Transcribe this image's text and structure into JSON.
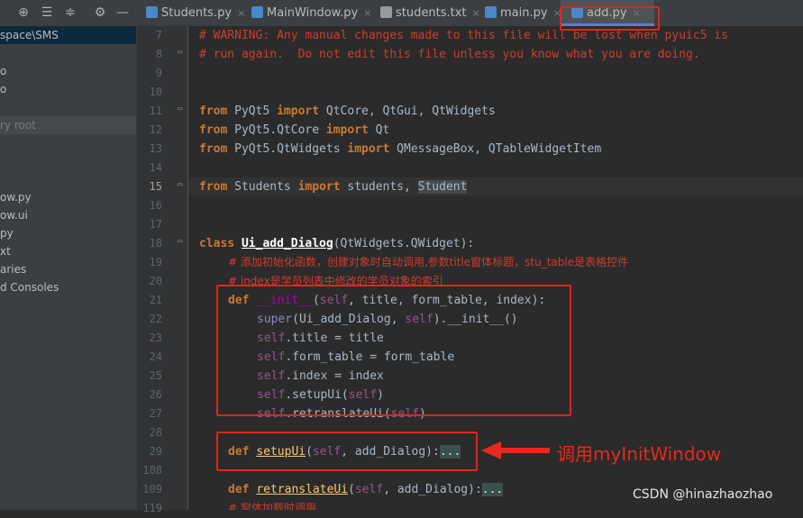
{
  "toolbar": {
    "icons": [
      "target-icon",
      "collapse-all-icon",
      "expand-all-icon",
      "gear-icon",
      "minimize-icon"
    ]
  },
  "project_tree": {
    "items": [
      {
        "label": "space\\SMS"
      },
      {
        "label": "o"
      },
      {
        "label": "o"
      },
      {
        "label": "ry root"
      },
      {
        "label": "ow.py"
      },
      {
        "label": "ow.ui"
      },
      {
        "label": "py"
      },
      {
        "label": "xt"
      },
      {
        "label": "aries"
      },
      {
        "label": "d Consoles"
      }
    ]
  },
  "tabs": [
    {
      "label": "Students.py",
      "close": "×",
      "color": "#4a88c7"
    },
    {
      "label": "MainWindow.py",
      "close": "×",
      "color": "#4a88c7"
    },
    {
      "label": "students.txt",
      "close": "×",
      "color": "#9a9a9a"
    },
    {
      "label": "main.py",
      "close": "×",
      "color": "#4a88c7"
    },
    {
      "label": "add.py",
      "close": "×",
      "color": "#4a88c7"
    }
  ],
  "editor": {
    "line_numbers": [
      "7",
      "8",
      "9",
      "10",
      "11",
      "12",
      "13",
      "14",
      "15",
      "16",
      "17",
      "18",
      "19",
      "20",
      "21",
      "22",
      "23",
      "24",
      "25",
      "26",
      "27",
      "28",
      "29",
      "108",
      "109",
      "119"
    ],
    "current_line": "15"
  },
  "code": {
    "l7": "# WARNING: Any manual changes made to this file will be lost when pyuic5 is",
    "l8": "# run again.  Do not edit this file unless you know what you are doing.",
    "l11_kw1": "from",
    "l11_a": " PyQt5 ",
    "l11_kw2": "import",
    "l11_b": " QtCore, QtGui, QtWidgets",
    "l12_kw1": "from",
    "l12_a": " PyQt5.QtCore ",
    "l12_kw2": "import",
    "l12_b": " Qt",
    "l13_kw1": "from",
    "l13_a": " PyQt5.QtWidgets ",
    "l13_kw2": "import",
    "l13_b": " QMessageBox, QTableWidgetItem",
    "l15_kw1": "from",
    "l15_a": " Students ",
    "l15_kw2": "import",
    "l15_b": " students, ",
    "l15_c": "Student",
    "l18_kw": "class",
    "l18_name": "Ui_add_Dialog",
    "l18_rest": "(QtWidgets.QWidget):",
    "l19": "# 添加初始化函数，创建对象时自动调用,参数title窗体标题，stu_table是表格控件",
    "l20": "# index是学员列表中修改的学员对象的索引",
    "l21_kw": "def",
    "l21_name": "__init__",
    "l21_p1": "(",
    "l21_self": "self",
    "l21_rest": ", title, form_table, index):",
    "l22_a": "super",
    "l22_b": "(Ui_add_Dialog, ",
    "l22_self": "self",
    "l22_c": ").__init__()",
    "l23_self": "self",
    "l23_rest": ".title = title",
    "l24_self": "self",
    "l24_rest": ".form_table = form_table",
    "l25_self": "self",
    "l25_rest": ".index = index",
    "l26_self": "self",
    "l26_a": ".setupUi(",
    "l26_self2": "self",
    "l26_b": ")",
    "l27_self": "self",
    "l27_a": ".retranslateUi(",
    "l27_self2": "self",
    "l27_b": ")",
    "l29_kw": "def",
    "l29_name": "setupUi",
    "l29_p1": "(",
    "l29_self": "self",
    "l29_rest": ", add_Dialog):",
    "l29_dots": "...",
    "l109_kw": "def",
    "l109_name": "retranslateUi",
    "l109_p1": "(",
    "l109_self": "self",
    "l109_rest": ", add_Dialog):",
    "l109_dots": "...",
    "l119": "# 窗体加载时调用"
  },
  "annotation": {
    "text": "调用myInitWindow",
    "color": "#e8281c"
  },
  "watermark": "CSDN @hinazhaozhao"
}
